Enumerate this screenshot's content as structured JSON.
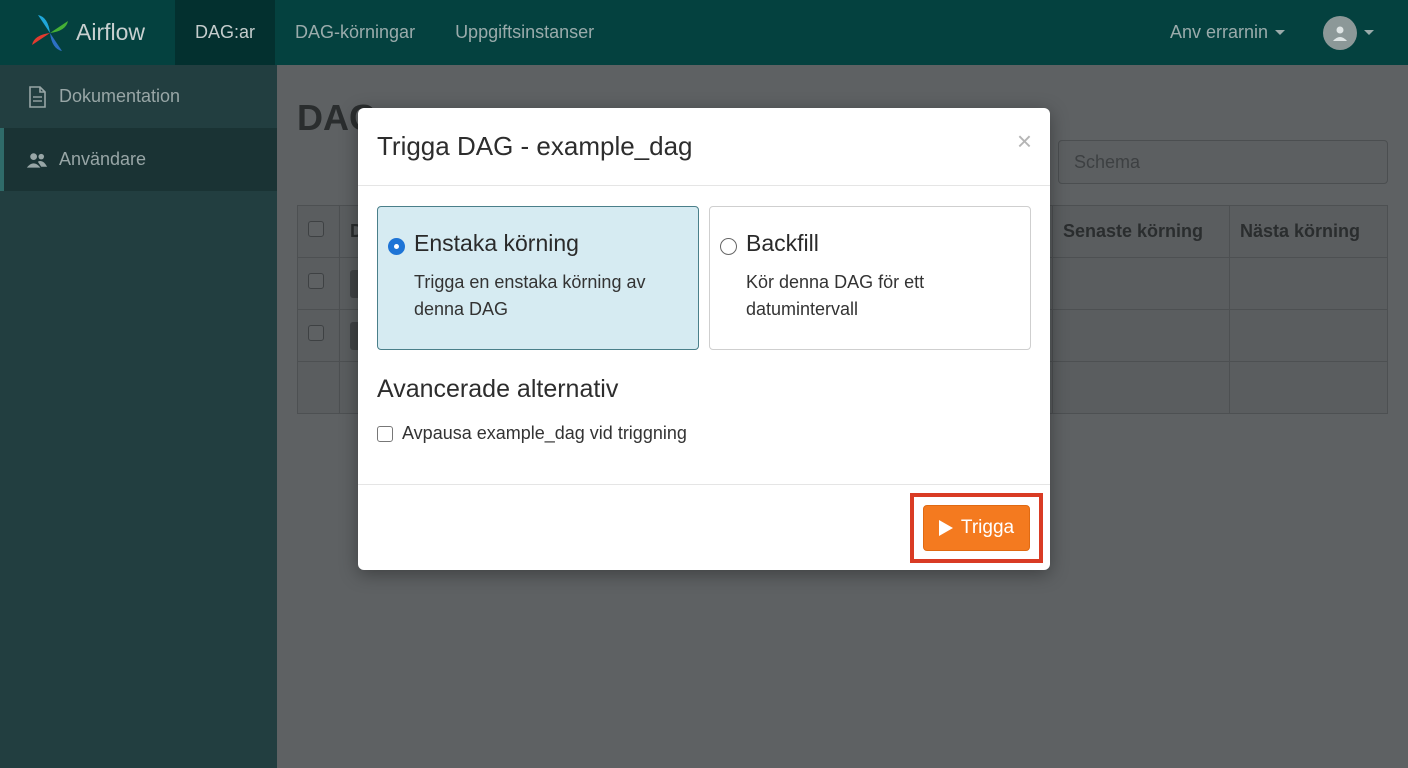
{
  "topnav": {
    "brand": "Airflow",
    "items": [
      "DAG:ar",
      "DAG-körningar",
      "Uppgiftsinstanser"
    ],
    "active_index": 0,
    "user_label": "Anv errarnin"
  },
  "sidebar": {
    "items": [
      {
        "label": "Dokumentation",
        "icon": "document-icon"
      },
      {
        "label": "Användare",
        "icon": "users-icon"
      }
    ],
    "active_index": 1
  },
  "main": {
    "page_title": "DAG",
    "search_placeholder": "Schema",
    "table_headers": [
      "D",
      "Senaste körning",
      "Nästa körning"
    ]
  },
  "modal": {
    "title": "Trigga DAG - example_dag",
    "close": "×",
    "options": [
      {
        "title": "Enstaka körning",
        "description": "Trigga en enstaka körning av denna DAG",
        "selected": true
      },
      {
        "title": "Backfill",
        "description": "Kör denna DAG för ett datumintervall",
        "selected": false
      }
    ],
    "advanced_title": "Avancerade alternativ",
    "unpause_label": "Avpausa example_dag vid triggning",
    "trigger_label": "Trigga"
  },
  "colors": {
    "nav_bg": "#04413f",
    "sidebar_bg": "#223e40",
    "selected_option_bg": "#d6ebf2",
    "radio_on": "#1e74d6",
    "trigger_button": "#f47a1f",
    "highlight": "#d93b24"
  }
}
